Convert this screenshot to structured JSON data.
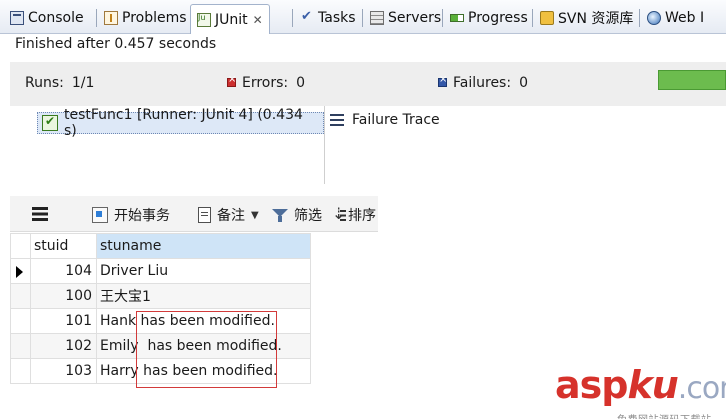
{
  "tabs": [
    {
      "label": "Console",
      "icon": "console-icon"
    },
    {
      "label": "Problems",
      "icon": "problems-icon"
    },
    {
      "label": "JUnit",
      "icon": "junit-icon",
      "active": true,
      "close": "✕"
    },
    {
      "label": "Tasks",
      "icon": "tasks-icon"
    },
    {
      "label": "Servers",
      "icon": "servers-icon"
    },
    {
      "label": "Progress",
      "icon": "progress-icon"
    },
    {
      "label": "SVN 资源库",
      "icon": "svn-icon"
    },
    {
      "label": "Web I",
      "icon": "web-browser-icon"
    }
  ],
  "junit": {
    "finished": "Finished after 0.457 seconds",
    "runs_label": "Runs:",
    "runs_value": "1/1",
    "errors_label": "Errors:",
    "errors_value": "0",
    "failures_label": "Failures:",
    "failures_value": "0",
    "progress_status_color": "#6cbc4e",
    "test_label": "testFunc1 [Runner: JUnit 4] (0.434 s)",
    "failure_trace": "Failure Trace"
  },
  "grid_toolbar": {
    "begin_transaction": "开始事务",
    "note": "备注",
    "filter": "筛选",
    "sort": "排序"
  },
  "table": {
    "columns": [
      "stuid",
      "stuname"
    ],
    "rows": [
      {
        "stuid": "104",
        "stuname": "Driver Liu"
      },
      {
        "stuid": "100",
        "stuname": "王大宝1"
      },
      {
        "stuid": "101",
        "stuname": "Hank",
        "suffix": "has been modified."
      },
      {
        "stuid": "102",
        "stuname": "Emily",
        "suffix": "has been modified."
      },
      {
        "stuid": "103",
        "stuname": "Harry",
        "suffix": "has been modified."
      }
    ],
    "highlight_color": "#d23a3a"
  },
  "watermark": {
    "main_a": "asp",
    "main_b": "ku",
    "main_c": ".com",
    "sub": "免费网站源码下载站"
  }
}
